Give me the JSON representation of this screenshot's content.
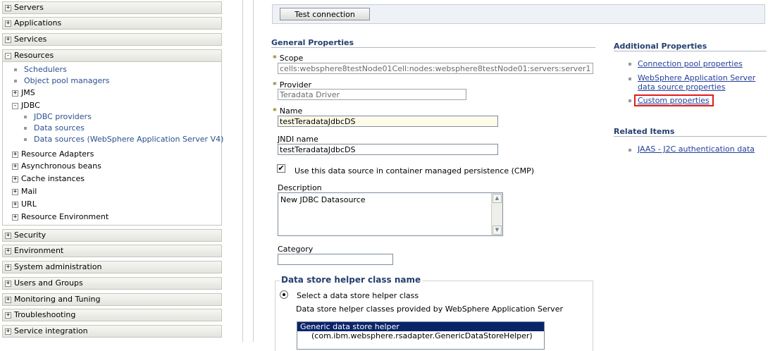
{
  "nav": {
    "sections": [
      {
        "label": "Servers",
        "toggle": "+"
      },
      {
        "label": "Applications",
        "toggle": "+"
      },
      {
        "label": "Services",
        "toggle": "+"
      },
      {
        "label": "Resources",
        "toggle": "-"
      }
    ],
    "resources": {
      "schedulers": "Schedulers",
      "object_pool_managers": "Object pool managers",
      "jms": "JMS",
      "jdbc": "JDBC",
      "jdbc_providers": "JDBC providers",
      "data_sources": "Data sources",
      "data_sources_v4": "Data sources (WebSphere Application Server V4)",
      "resource_adapters": "Resource Adapters",
      "asynchronous_beans": "Asynchronous beans",
      "cache_instances": "Cache instances",
      "mail": "Mail",
      "url": "URL",
      "resource_environment": "Resource Environment"
    },
    "lower_sections": [
      {
        "label": "Security",
        "toggle": "+"
      },
      {
        "label": "Environment",
        "toggle": "+"
      },
      {
        "label": "System administration",
        "toggle": "+"
      },
      {
        "label": "Users and Groups",
        "toggle": "+"
      },
      {
        "label": "Monitoring and Tuning",
        "toggle": "+"
      },
      {
        "label": "Troubleshooting",
        "toggle": "+"
      },
      {
        "label": "Service integration",
        "toggle": "+"
      }
    ]
  },
  "toolbar": {
    "test_connection": "Test connection"
  },
  "general": {
    "title": "General Properties",
    "required_marker": "*",
    "scope_label": "Scope",
    "scope_value": "cells:websphere8testNode01Cell:nodes:websphere8testNode01:servers:server1",
    "provider_label": "Provider",
    "provider_value": "Teradata Driver",
    "name_label": "Name",
    "name_value": "testTeradataJdbcDS",
    "jndi_label": "JNDI name",
    "jndi_value": "testTeradataJdbcDS",
    "cmp_label": "Use this data source in container managed persistence (CMP)",
    "cmp_checked": "✔",
    "description_label": "Description",
    "description_value": "New JDBC Datasource",
    "category_label": "Category",
    "category_value": ""
  },
  "helper": {
    "title": "Data store helper class name",
    "radio_label": "Select a data store helper class",
    "sub_label": "Data store helper classes provided by WebSphere Application Server",
    "options": [
      "Generic data store helper",
      "(com.ibm.websphere.rsadapter.GenericDataStoreHelper)"
    ]
  },
  "additional": {
    "title": "Additional Properties",
    "connection_pool": "Connection pool properties",
    "was_ds_line1": "WebSphere Application Server",
    "was_ds_line2": "data source properties",
    "custom_properties": "Custom properties"
  },
  "related": {
    "title": "Related Items",
    "jaas": "JAAS - J2C authentication data"
  },
  "colors": {
    "highlight_box": "#e01b1b",
    "link": "#243f9a",
    "section_title": "#243f6e"
  }
}
